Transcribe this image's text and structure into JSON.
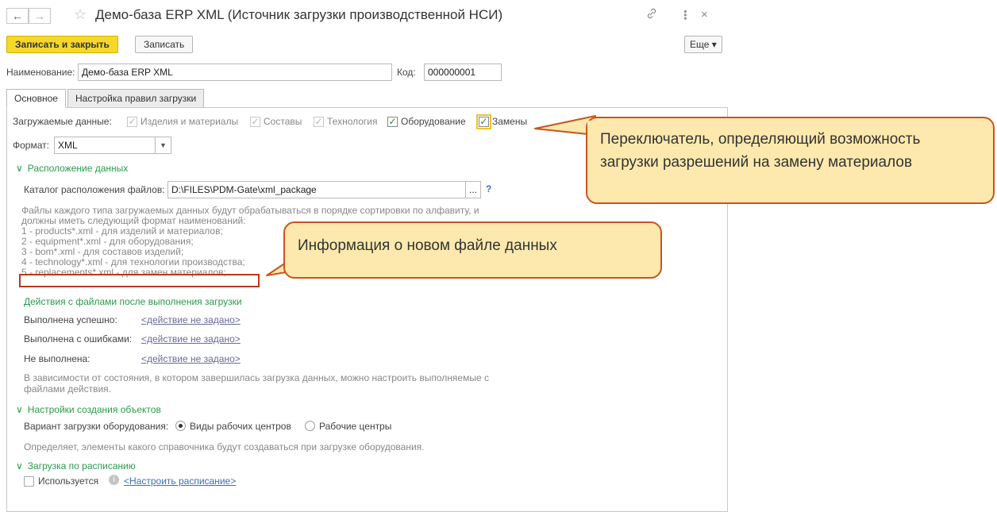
{
  "window": {
    "title": "Демо-база ERP XML (Источник загрузки производственной НСИ)",
    "back_icon": "←",
    "forward_icon": "→",
    "star_icon": "☆",
    "link_icon": "🔗",
    "more_icon": "⋮",
    "close_icon": "×"
  },
  "toolbar": {
    "save_close": "Записать и закрыть",
    "save": "Записать",
    "more": "Еще ▾"
  },
  "form": {
    "name_label": "Наименование:",
    "name_value": "Демо-база ERP XML",
    "code_label": "Код:",
    "code_value": "000000001"
  },
  "tabs": [
    "Основное",
    "Настройка правил загрузки"
  ],
  "loaded_data": {
    "label": "Загружаемые данные:",
    "items": [
      {
        "label": "Изделия и материалы",
        "checked": true,
        "enabled": false
      },
      {
        "label": "Составы",
        "checked": true,
        "enabled": false
      },
      {
        "label": "Технология",
        "checked": true,
        "enabled": false
      },
      {
        "label": "Оборудование",
        "checked": true,
        "enabled": true
      },
      {
        "label": "Замены",
        "checked": true,
        "enabled": true
      }
    ]
  },
  "format": {
    "label": "Формат:",
    "value": "XML"
  },
  "location": {
    "section_title": "Расположение данных",
    "catalog_label": "Каталог расположения файлов:",
    "catalog_value": "D:\\FILES\\PDM-Gate\\xml_package",
    "browse": "...",
    "help": "?",
    "info_lines": [
      "Файлы каждого типа загружаемых данных будут обрабатываться в порядке сортировки по алфавиту, и",
      "должны иметь следующий формат наименований:",
      "1 - products*.xml - для изделий и материалов;",
      "2 - equipment*.xml - для оборудования;",
      "3 - bom*.xml - для составов изделий;",
      "4 - technology*.xml - для технологии производства;",
      "5 - replacements*.xml - для замен материалов;"
    ]
  },
  "actions": {
    "section_title": "Действия с файлами после выполнения загрузки",
    "rows": [
      {
        "label": "Выполнена успешно:",
        "value": "<действие не задано>"
      },
      {
        "label": "Выполнена с ошибками:",
        "value": "<действие не задано>"
      },
      {
        "label": "Не выполнена:",
        "value": "<действие не задано>"
      }
    ],
    "note_lines": [
      "В зависимости от состояния, в котором завершилась загрузка данных, можно настроить выполняемые с",
      "файлами действия."
    ]
  },
  "objects": {
    "section_title": "Настройки создания объектов",
    "variant_label": "Вариант загрузки оборудования:",
    "options": [
      "Виды рабочих центров",
      "Рабочие центры"
    ],
    "selected": 0,
    "note": "Определяет, элементы какого справочника будут создаваться при загрузке оборудования."
  },
  "schedule": {
    "section_title": "Загрузка по расписанию",
    "used_label": "Используется",
    "setup_link": "<Настроить расписание>"
  },
  "callouts": {
    "switch_text": "Переключатель, определяющий возможность загрузки разрешений на замену материалов",
    "info_text": "Информация о новом файле данных"
  },
  "colors": {
    "accent_button": "#f6d82b",
    "section_green": "#2a9a4a",
    "callout_fill": "#fde9ad",
    "callout_border": "#c9541e"
  }
}
